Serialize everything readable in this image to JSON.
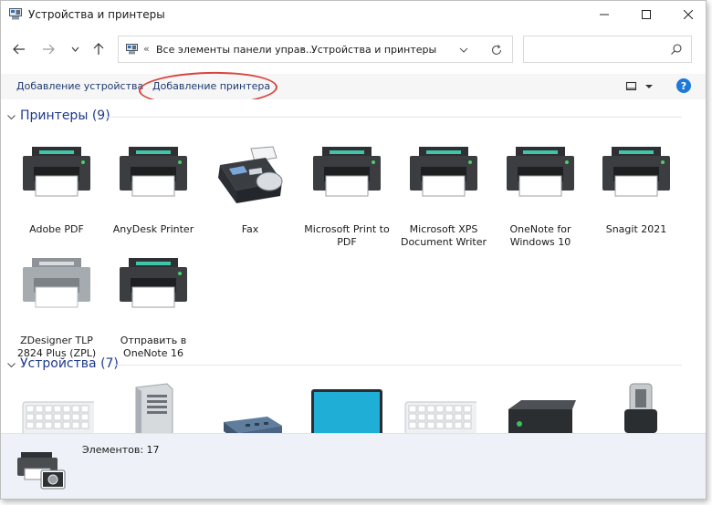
{
  "window": {
    "title": "Устройства и принтеры"
  },
  "address": {
    "crumb_root": "Все элементы панели управ...",
    "crumb_current": "Устройства и принтеры",
    "prefix": "«",
    "separator": "›"
  },
  "search": {
    "placeholder": ""
  },
  "commands": {
    "add_device": "Добавление устройства",
    "add_printer": "Добавление принтера",
    "help": "?"
  },
  "groups": {
    "printers": {
      "title": "Принтеры (9)",
      "items": [
        {
          "label": "Adobe PDF",
          "icon": "printer-icon"
        },
        {
          "label": "AnyDesk Printer",
          "icon": "printer-icon"
        },
        {
          "label": "Fax",
          "icon": "fax-icon"
        },
        {
          "label": "Microsoft Print to PDF",
          "icon": "printer-icon"
        },
        {
          "label": "Microsoft XPS Document Writer",
          "icon": "printer-icon"
        },
        {
          "label": "OneNote for Windows 10",
          "icon": "printer-icon"
        },
        {
          "label": "Snagit 2021",
          "icon": "printer-icon"
        },
        {
          "label": "ZDesigner TLP 2824 Plus (ZPL)",
          "icon": "label-printer-icon"
        },
        {
          "label": "Отправить в OneNote 16",
          "icon": "printer-icon"
        }
      ]
    },
    "devices": {
      "title": "Устройства (7)",
      "items": [
        {
          "icon": "keyboard-icon"
        },
        {
          "icon": "computer-tower-icon"
        },
        {
          "icon": "usb-hub-icon"
        },
        {
          "icon": "monitor-icon"
        },
        {
          "icon": "keyboard-icon"
        },
        {
          "icon": "external-drive-icon"
        },
        {
          "icon": "usb-flash-drive-icon"
        }
      ]
    }
  },
  "status": {
    "count_text": "Элементов: 17"
  },
  "colors": {
    "accent": "#1f79d9",
    "group_title": "#1e3a8a",
    "highlight_ellipse": "#d6453d"
  }
}
